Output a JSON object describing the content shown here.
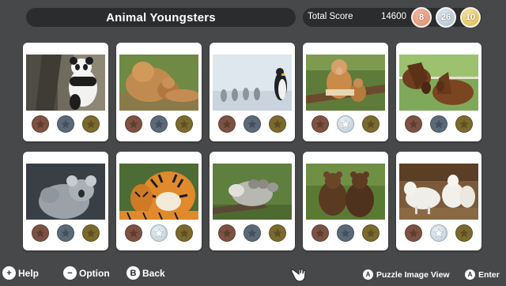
{
  "header": {
    "title": "Animal Youngsters",
    "total_score_label": "Total Score",
    "total_score_value": "14600",
    "medal_counts": {
      "bronze": "8",
      "silver": "26",
      "gold": "10"
    }
  },
  "colors": {
    "background": "#47484a",
    "pill": "#2b2c2e",
    "card": "#ffffff"
  },
  "puzzles": [
    {
      "name": "panda",
      "medals": [
        "bronze-empty",
        "silver-empty",
        "gold-empty"
      ]
    },
    {
      "name": "lions",
      "medals": [
        "bronze-empty",
        "silver-empty",
        "gold-empty"
      ]
    },
    {
      "name": "penguins",
      "medals": [
        "bronze-empty",
        "silver-empty",
        "gold-empty"
      ]
    },
    {
      "name": "proboscis-monkeys",
      "medals": [
        "bronze-empty",
        "silver-won",
        "gold-empty"
      ]
    },
    {
      "name": "horses",
      "medals": [
        "bronze-empty",
        "silver-empty",
        "gold-empty"
      ]
    },
    {
      "name": "koalas",
      "medals": [
        "bronze-empty",
        "silver-empty",
        "gold-empty"
      ]
    },
    {
      "name": "tigers",
      "medals": [
        "bronze-empty",
        "silver-won",
        "gold-empty"
      ]
    },
    {
      "name": "opossums",
      "medals": [
        "bronze-empty",
        "silver-empty",
        "gold-empty"
      ]
    },
    {
      "name": "bear-cubs",
      "medals": [
        "bronze-empty",
        "silver-empty",
        "gold-empty"
      ]
    },
    {
      "name": "lambs",
      "medals": [
        "bronze-empty",
        "silver-won",
        "gold-empty"
      ]
    }
  ],
  "footer": {
    "help_key": "+",
    "help_label": "Help",
    "option_key": "−",
    "option_label": "Option",
    "back_key": "B",
    "back_label": "Back",
    "puzzle_view_key": "A",
    "puzzle_view_label": "Puzzle Image View",
    "enter_key": "A",
    "enter_label": "Enter"
  }
}
